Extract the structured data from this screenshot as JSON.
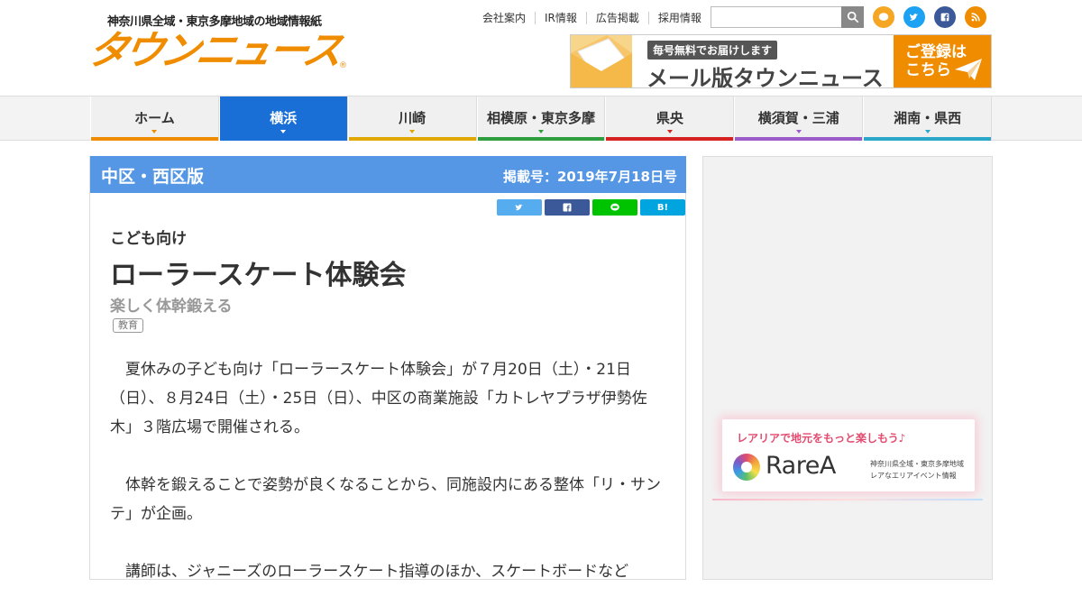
{
  "header": {
    "tagline": "神奈川県全域・東京多摩地域の地域情報紙",
    "logo_text": "タウンニュース",
    "logo_mark": "®",
    "top_links": [
      "会社案内",
      "IR情報",
      "広告掲載",
      "採用情報"
    ],
    "search_placeholder": "",
    "social_icons": [
      "line-icon",
      "twitter-icon",
      "facebook-icon",
      "rss-icon"
    ],
    "mail_banner": {
      "badge": "毎号無料でお届けします",
      "title": "メール版タウンニュース",
      "cta_line1": "ご登録は",
      "cta_line2": "こちら"
    }
  },
  "nav": {
    "items": [
      {
        "label": "ホーム",
        "color": "#f08c00",
        "active": false
      },
      {
        "label": "横浜",
        "color": "#1a6fd6",
        "active": true
      },
      {
        "label": "川崎",
        "color": "#e0a800",
        "active": false
      },
      {
        "label": "相模原・東京多摩",
        "color": "#2e9e3e",
        "active": false
      },
      {
        "label": "県央",
        "color": "#d52121",
        "active": false
      },
      {
        "label": "横須賀・三浦",
        "color": "#9b5bc9",
        "active": false
      },
      {
        "label": "湘南・県西",
        "color": "#2aa7c9",
        "active": false
      }
    ]
  },
  "article": {
    "edition": "中区・西区版",
    "published": "掲載号：2019年7月18日号",
    "share_buttons": [
      {
        "name": "twitter-share",
        "color": "#55acee"
      },
      {
        "name": "facebook-share",
        "color": "#3b5998"
      },
      {
        "name": "line-share",
        "color": "#00c300"
      },
      {
        "name": "hatena-share",
        "color": "#00a4de",
        "text": "B!"
      }
    ],
    "category": "こども向け",
    "headline": "ローラースケート体験会",
    "subhead": "楽しく体幹鍛える",
    "tag": "教育",
    "paragraphs": [
      "夏休みの子ども向け「ローラースケート体験会」が７月20日（土）・21日（日）、８月24日（土）・25日（日）、中区の商業施設「カトレヤプラザ伊勢佐木」３階広場で開催される。",
      "体幹を鍛えることで姿勢が良くなることから、同施設内にある整体「リ・サンテ」が企画。",
      "講師は、ジャニーズのローラースケート指導のほか、スケートボードなど"
    ]
  },
  "sidebar": {
    "rarea": {
      "tagline": "レアリアで地元をもっと楽しもう♪",
      "brand": "RareA",
      "desc_line1": "神奈川県全域・東京多摩地域",
      "desc_line2": "レアなエリアイベント情報"
    }
  }
}
